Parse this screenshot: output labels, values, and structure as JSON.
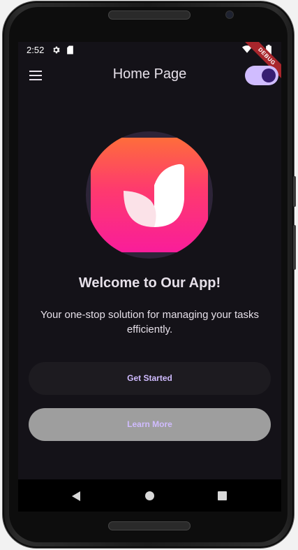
{
  "status_bar": {
    "time": "2:52",
    "icons": [
      "gear-icon",
      "sd-card-icon",
      "wifi-icon",
      "battery-icon"
    ],
    "debug_banner": "DEBUG"
  },
  "app_bar": {
    "title": "Home Page",
    "menu_icon": "hamburger-menu-icon",
    "theme_toggle_on": true
  },
  "hero": {
    "logo_icon": "app-logo-icon",
    "headline": "Welcome to Our App!",
    "subtext": "Your one-stop solution for managing your tasks efficiently."
  },
  "buttons": {
    "get_started": "Get Started",
    "learn_more": "Learn More"
  },
  "nav_bar": {
    "icons": [
      "back-icon",
      "home-icon",
      "recents-icon"
    ]
  },
  "colors": {
    "background": "#141218",
    "on_surface": "#e6e0e9",
    "primary": "#d0bcff",
    "on_primary": "#381e72",
    "logo_gradient_top": "#fe6d3b",
    "logo_gradient_bottom": "#f91d9a",
    "secondary_button": "#9e9e9e"
  }
}
